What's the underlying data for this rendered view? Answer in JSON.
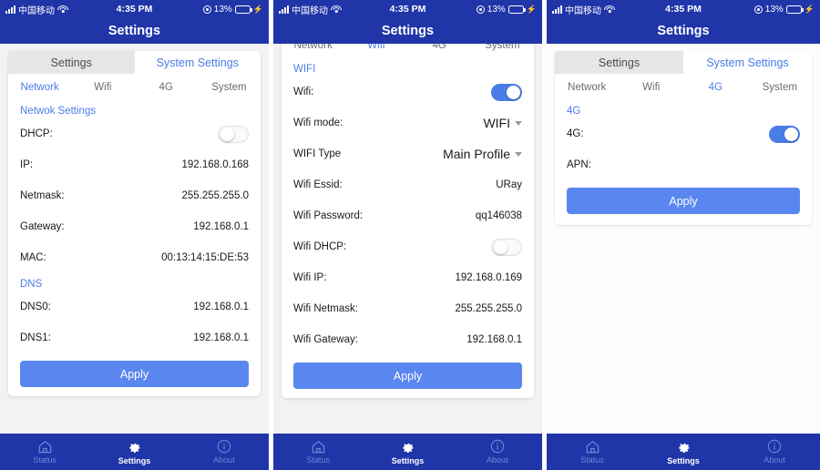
{
  "statusbar": {
    "carrier": "中国移动",
    "time": "4:35 PM",
    "battery_percent": "13%",
    "charging_glyph": "⚡",
    "signal_icon": "signal-bars-icon",
    "wifi_icon": "wifi-icon",
    "location_icon": "location-services-icon",
    "battery_icon": "battery-icon"
  },
  "navbar": {
    "title": "Settings"
  },
  "segments": {
    "settings": "Settings",
    "system_settings": "System Settings"
  },
  "tabs": {
    "network": "Network",
    "wifi": "Wifi",
    "fourg": "4G",
    "system": "System"
  },
  "tabbar": {
    "status": "Status",
    "settings": "Settings",
    "about": "About",
    "status_icon": "home-icon",
    "settings_icon": "gear-icon",
    "about_icon": "info-circle-icon"
  },
  "apply_label": "Apply",
  "colors": {
    "brand_blue": "#1f35a8",
    "accent_blue": "#4a7ce8",
    "button_blue": "#5a86ef",
    "toggle_on": "#4a7ce8",
    "battery_low": "#e8554a",
    "page_bg": "#f2f2f4"
  },
  "panel_network": {
    "section": "Netwok Settings",
    "dns_section": "DNS",
    "rows": [
      {
        "label": "DHCP:",
        "type": "toggle",
        "state": "off"
      },
      {
        "label": "IP:",
        "type": "value",
        "value": "192.168.0.168"
      },
      {
        "label": "Netmask:",
        "type": "value",
        "value": "255.255.255.0"
      },
      {
        "label": "Gateway:",
        "type": "value",
        "value": "192.168.0.1"
      },
      {
        "label": "MAC:",
        "type": "value",
        "value": "00:13:14:15:DE:53"
      }
    ],
    "dns_rows": [
      {
        "label": "DNS0:",
        "value": "192.168.0.1"
      },
      {
        "label": "DNS1:",
        "value": "192.168.0.1"
      }
    ]
  },
  "panel_wifi": {
    "section": "WIFI",
    "rows": [
      {
        "label": "Wifi:",
        "type": "toggle",
        "state": "on"
      },
      {
        "label": "Wifi mode:",
        "type": "select",
        "value": "WIFI"
      },
      {
        "label": "WIFI Type",
        "type": "select",
        "value": "Main Profile"
      },
      {
        "label": "Wifi Essid:",
        "type": "value",
        "value": "URay"
      },
      {
        "label": "Wifi Password:",
        "type": "value",
        "value": "qq146038"
      },
      {
        "label": "Wifi DHCP:",
        "type": "toggle",
        "state": "off"
      },
      {
        "label": "Wifi IP:",
        "type": "value",
        "value": "192.168.0.169"
      },
      {
        "label": "Wifi Netmask:",
        "type": "value",
        "value": "255.255.255.0"
      },
      {
        "label": "Wifi Gateway:",
        "type": "value",
        "value": "192.168.0.1"
      }
    ]
  },
  "panel_4g": {
    "section": "4G",
    "rows": [
      {
        "label": "4G:",
        "type": "toggle",
        "state": "on"
      },
      {
        "label": "APN:",
        "type": "value",
        "value": ""
      }
    ]
  }
}
